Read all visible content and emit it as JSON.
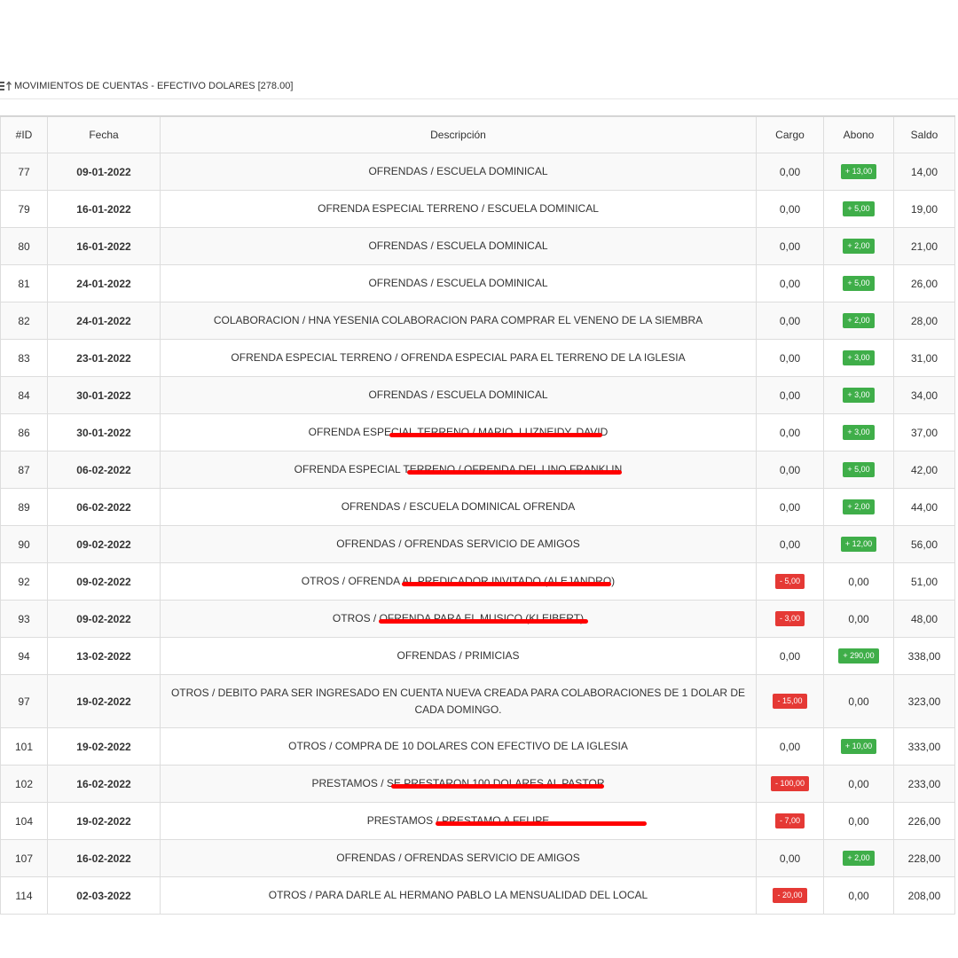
{
  "header": {
    "title": "MOVIMIENTOS DE CUENTAS - EFECTIVO DOLARES [278.00]",
    "icon": "sort-icon"
  },
  "table": {
    "columns": [
      "#ID",
      "Fecha",
      "Descripción",
      "Cargo",
      "Abono",
      "Saldo"
    ],
    "rows": [
      {
        "id": "77",
        "fecha": "09-01-2022",
        "desc": "OFRENDAS / ESCUELA DOMINICAL",
        "cargo": "0,00",
        "cargo_type": "plain",
        "abono": "+ 13,00",
        "abono_type": "green",
        "saldo": "14,00",
        "h": 42
      },
      {
        "id": "79",
        "fecha": "16-01-2022",
        "desc": "OFRENDA ESPECIAL TERRENO / ESCUELA DOMINICAL",
        "cargo": "0,00",
        "cargo_type": "plain",
        "abono": "+ 5,00",
        "abono_type": "green",
        "saldo": "19,00",
        "h": 42
      },
      {
        "id": "80",
        "fecha": "16-01-2022",
        "desc": "OFRENDAS / ESCUELA DOMINICAL",
        "cargo": "0,00",
        "cargo_type": "plain",
        "abono": "+ 2,00",
        "abono_type": "green",
        "saldo": "21,00",
        "h": 42
      },
      {
        "id": "81",
        "fecha": "24-01-2022",
        "desc": "OFRENDAS / ESCUELA DOMINICAL",
        "cargo": "0,00",
        "cargo_type": "plain",
        "abono": "+ 5,00",
        "abono_type": "green",
        "saldo": "26,00",
        "h": 42
      },
      {
        "id": "82",
        "fecha": "24-01-2022",
        "desc": "COLABORACION / HNA YESENIA COLABORACION PARA COMPRAR EL VENENO DE LA SIEMBRA",
        "cargo": "0,00",
        "cargo_type": "plain",
        "abono": "+ 2,00",
        "abono_type": "green",
        "saldo": "28,00",
        "h": 42
      },
      {
        "id": "83",
        "fecha": "23-01-2022",
        "desc": "OFRENDA ESPECIAL TERRENO / OFRENDA ESPECIAL PARA EL TERRENO DE LA IGLESIA",
        "cargo": "0,00",
        "cargo_type": "plain",
        "abono": "+ 3,00",
        "abono_type": "green",
        "saldo": "31,00",
        "h": 42
      },
      {
        "id": "84",
        "fecha": "30-01-2022",
        "desc": "OFRENDAS / ESCUELA DOMINICAL",
        "cargo": "0,00",
        "cargo_type": "plain",
        "abono": "+ 3,00",
        "abono_type": "green",
        "saldo": "34,00",
        "h": 42
      },
      {
        "id": "86",
        "fecha": "30-01-2022",
        "desc": "OFRENDA ESPECIAL TERRENO / MARIO, LUZNEIDY, DAVID",
        "cargo": "0,00",
        "cargo_type": "plain",
        "abono": "+ 3,00",
        "abono_type": "green",
        "saldo": "37,00",
        "h": 42,
        "redact": [
          438,
          678
        ]
      },
      {
        "id": "87",
        "fecha": "06-02-2022",
        "desc": "OFRENDA ESPECIAL TERRENO / OFRENDA DEL LINO FRANKLIN",
        "cargo": "0,00",
        "cargo_type": "plain",
        "abono": "+ 5,00",
        "abono_type": "green",
        "saldo": "42,00",
        "h": 42,
        "redact": [
          458,
          700
        ]
      },
      {
        "id": "89",
        "fecha": "06-02-2022",
        "desc": "OFRENDAS / ESCUELA DOMINICAL OFRENDA",
        "cargo": "0,00",
        "cargo_type": "plain",
        "abono": "+ 2,00",
        "abono_type": "green",
        "saldo": "44,00",
        "h": 42
      },
      {
        "id": "90",
        "fecha": "09-02-2022",
        "desc": "OFRENDAS / OFRENDAS SERVICIO DE AMIGOS",
        "cargo": "0,00",
        "cargo_type": "plain",
        "abono": "+ 12,00",
        "abono_type": "green",
        "saldo": "56,00",
        "h": 42
      },
      {
        "id": "92",
        "fecha": "09-02-2022",
        "desc": "OTROS / OFRENDA AL PREDICADOR INVITADO (ALEJANDRO)",
        "cargo": "- 5,00",
        "cargo_type": "red",
        "abono": "0,00",
        "abono_type": "plain",
        "saldo": "51,00",
        "h": 42,
        "redact": [
          452,
          688
        ]
      },
      {
        "id": "93",
        "fecha": "09-02-2022",
        "desc": "OTROS / OFRENDA PARA EL MUSICO (KLEIBERT)",
        "cargo": "- 3,00",
        "cargo_type": "red",
        "abono": "0,00",
        "abono_type": "plain",
        "saldo": "48,00",
        "h": 42,
        "redact": [
          426,
          662
        ]
      },
      {
        "id": "94",
        "fecha": "13-02-2022",
        "desc": "OFRENDAS / PRIMICIAS",
        "cargo": "0,00",
        "cargo_type": "plain",
        "abono": "+ 290,00",
        "abono_type": "green",
        "saldo": "338,00",
        "h": 42
      },
      {
        "id": "97",
        "fecha": "19-02-2022",
        "desc": "OTROS / DEBITO PARA SER INGRESADO EN CUENTA NUEVA CREADA PARA COLABORACIONES DE 1 DOLAR DE CADA DOMINGO.",
        "cargo": "- 15,00",
        "cargo_type": "red",
        "abono": "0,00",
        "abono_type": "plain",
        "saldo": "323,00",
        "h": 60
      },
      {
        "id": "101",
        "fecha": "19-02-2022",
        "desc": "OTROS / COMPRA DE 10 DOLARES CON EFECTIVO DE LA IGLESIA",
        "cargo": "0,00",
        "cargo_type": "plain",
        "abono": "+ 10,00",
        "abono_type": "green",
        "saldo": "333,00",
        "h": 42
      },
      {
        "id": "102",
        "fecha": "16-02-2022",
        "desc": "PRESTAMOS / SE PRESTARON 100 DOLARES AL PASTOR",
        "cargo": "- 100,00",
        "cargo_type": "red",
        "abono": "0,00",
        "abono_type": "plain",
        "saldo": "233,00",
        "h": 42,
        "redact": [
          440,
          680
        ]
      },
      {
        "id": "104",
        "fecha": "19-02-2022",
        "desc": "PRESTAMOS / PRESTAMO A FELIPE",
        "cargo": "- 7,00",
        "cargo_type": "red",
        "abono": "0,00",
        "abono_type": "plain",
        "saldo": "226,00",
        "h": 42,
        "redact": [
          490,
          728
        ]
      },
      {
        "id": "107",
        "fecha": "16-02-2022",
        "desc": "OFRENDAS / OFRENDAS SERVICIO DE AMIGOS",
        "cargo": "0,00",
        "cargo_type": "plain",
        "abono": "+ 2,00",
        "abono_type": "green",
        "saldo": "228,00",
        "h": 42
      },
      {
        "id": "114",
        "fecha": "02-03-2022",
        "desc": "OTROS / PARA DARLE AL HERMANO PABLO LA MENSUALIDAD DEL LOCAL",
        "cargo": "- 20,00",
        "cargo_type": "red",
        "abono": "0,00",
        "abono_type": "plain",
        "saldo": "208,00",
        "h": 42
      }
    ]
  }
}
